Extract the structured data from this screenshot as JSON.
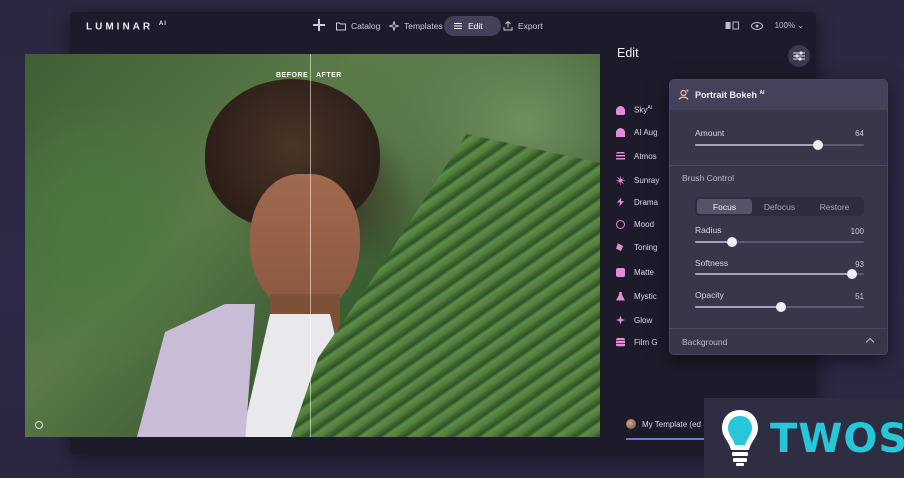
{
  "app": {
    "logo": "LUMINAR",
    "logo_sup": "AI"
  },
  "toolbar": {
    "catalog_label": "Catalog",
    "templates_label": "Templates",
    "edit_label": "Edit",
    "export_label": "Export",
    "zoom": "100%"
  },
  "photo": {
    "before_label": "BEFORE",
    "after_label": "AFTER"
  },
  "panel": {
    "title": "Edit",
    "tools": [
      {
        "label": "Sky",
        "sup": "AI",
        "color": "#e58ad6"
      },
      {
        "label": "AI Aug",
        "sup": "",
        "color": "#e58ad6"
      },
      {
        "label": "Atmos",
        "sup": "",
        "color": "#e58ad6"
      },
      {
        "label": "Sunray",
        "sup": "",
        "color": "#e58ad6"
      },
      {
        "label": "Drama",
        "sup": "",
        "color": "#e58ad6"
      },
      {
        "label": "Mood",
        "sup": "",
        "color": "#e58ad6"
      },
      {
        "label": "Toning",
        "sup": "",
        "color": "#e58ad6"
      },
      {
        "label": "Matte",
        "sup": "",
        "color": "#e58ad6"
      },
      {
        "label": "Mystic",
        "sup": "",
        "color": "#e58ad6"
      },
      {
        "label": "Glow",
        "sup": "",
        "color": "#e58ad6"
      },
      {
        "label": "Film G",
        "sup": "",
        "color": "#e58ad6"
      }
    ],
    "template_label": "My Template (ed"
  },
  "bokeh": {
    "title": "Portrait Bokeh",
    "title_sup": "AI",
    "amount_label": "Amount",
    "amount_value": "64",
    "brush_control_label": "Brush Control",
    "modes": [
      "Focus",
      "Defocus",
      "Restore"
    ],
    "active_mode": "Focus",
    "radius_label": "Radius",
    "radius_value": "100",
    "softness_label": "Softness",
    "softness_value": "93",
    "opacity_label": "Opacity",
    "opacity_value": "51",
    "background_label": "Background"
  },
  "watermark": {
    "text": "TWOS"
  }
}
